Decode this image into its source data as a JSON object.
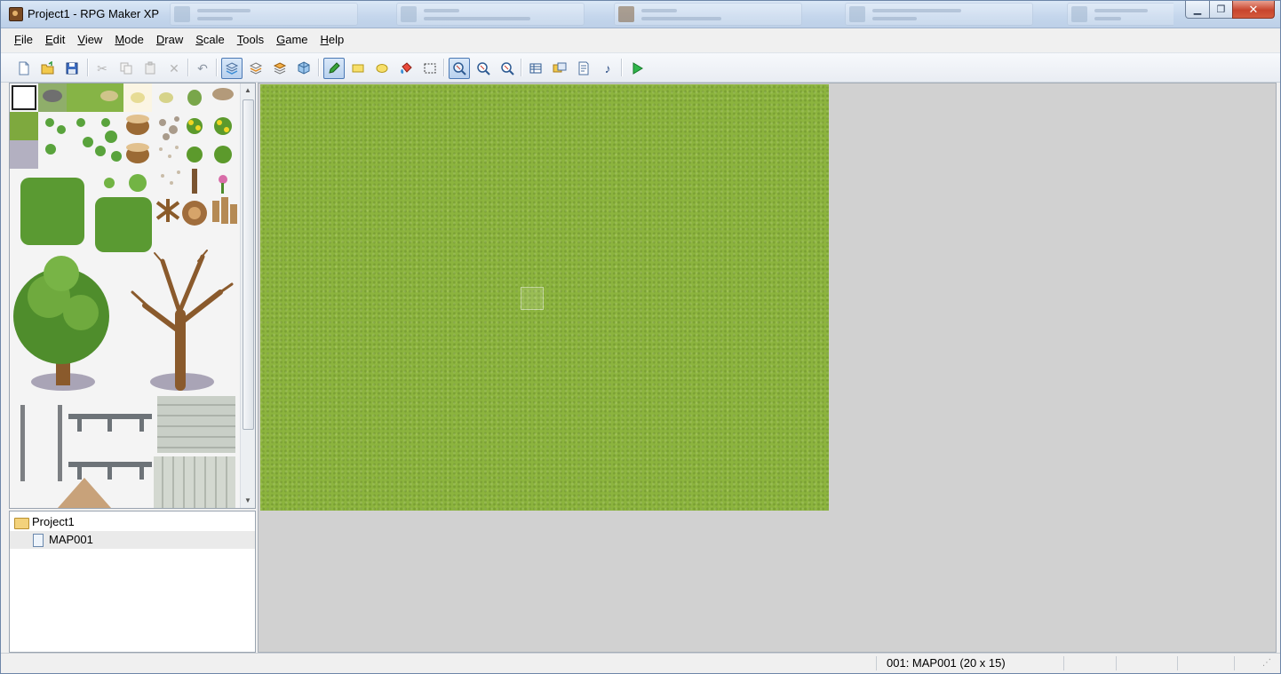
{
  "window": {
    "title": "Project1 - RPG Maker XP"
  },
  "menu": [
    {
      "pre": "",
      "u": "F",
      "post": "ile"
    },
    {
      "pre": "",
      "u": "E",
      "post": "dit"
    },
    {
      "pre": "",
      "u": "V",
      "post": "iew"
    },
    {
      "pre": "",
      "u": "M",
      "post": "ode"
    },
    {
      "pre": "",
      "u": "D",
      "post": "raw"
    },
    {
      "pre": "",
      "u": "S",
      "post": "cale"
    },
    {
      "pre": "",
      "u": "T",
      "post": "ools"
    },
    {
      "pre": "",
      "u": "G",
      "post": "ame"
    },
    {
      "pre": "",
      "u": "H",
      "post": "elp"
    }
  ],
  "toolbar": [
    {
      "name": "new-project",
      "icon": "new-file-icon"
    },
    {
      "name": "open-project",
      "icon": "open-folder-icon"
    },
    {
      "name": "save-project",
      "icon": "save-icon"
    },
    {
      "name": "cut",
      "icon": "cut-icon"
    },
    {
      "name": "copy",
      "icon": "copy-icon"
    },
    {
      "name": "paste",
      "icon": "paste-icon"
    },
    {
      "name": "delete",
      "icon": "delete-icon"
    },
    {
      "name": "undo",
      "icon": "undo-icon"
    },
    {
      "name": "layer-1",
      "icon": "layer1-icon"
    },
    {
      "name": "layer-2",
      "icon": "layer2-icon"
    },
    {
      "name": "layer-3",
      "icon": "layer3-icon"
    },
    {
      "name": "events-layer",
      "icon": "events-icon"
    },
    {
      "name": "pencil",
      "icon": "pencil-icon"
    },
    {
      "name": "rectangle",
      "icon": "rectangle-icon"
    },
    {
      "name": "ellipse",
      "icon": "ellipse-icon"
    },
    {
      "name": "flood-fill",
      "icon": "fill-icon"
    },
    {
      "name": "select",
      "icon": "select-icon"
    },
    {
      "name": "zoom-1-1",
      "icon": "zoom-1-1-icon"
    },
    {
      "name": "zoom-1-2",
      "icon": "zoom-1-2-icon"
    },
    {
      "name": "zoom-1-4",
      "icon": "zoom-1-4-icon"
    },
    {
      "name": "database",
      "icon": "database-icon"
    },
    {
      "name": "materialbase",
      "icon": "materialbase-icon"
    },
    {
      "name": "script-editor",
      "icon": "script-icon"
    },
    {
      "name": "sound-test",
      "icon": "sound-icon"
    },
    {
      "name": "playtest",
      "icon": "play-icon"
    }
  ],
  "map_tree": {
    "project": "Project1",
    "maps": [
      "MAP001"
    ]
  },
  "status": {
    "map_info": "001: MAP001 (20 x 15)"
  },
  "colors": {
    "grass": "#8cb43e",
    "editor_bg": "#d1d1d1"
  }
}
